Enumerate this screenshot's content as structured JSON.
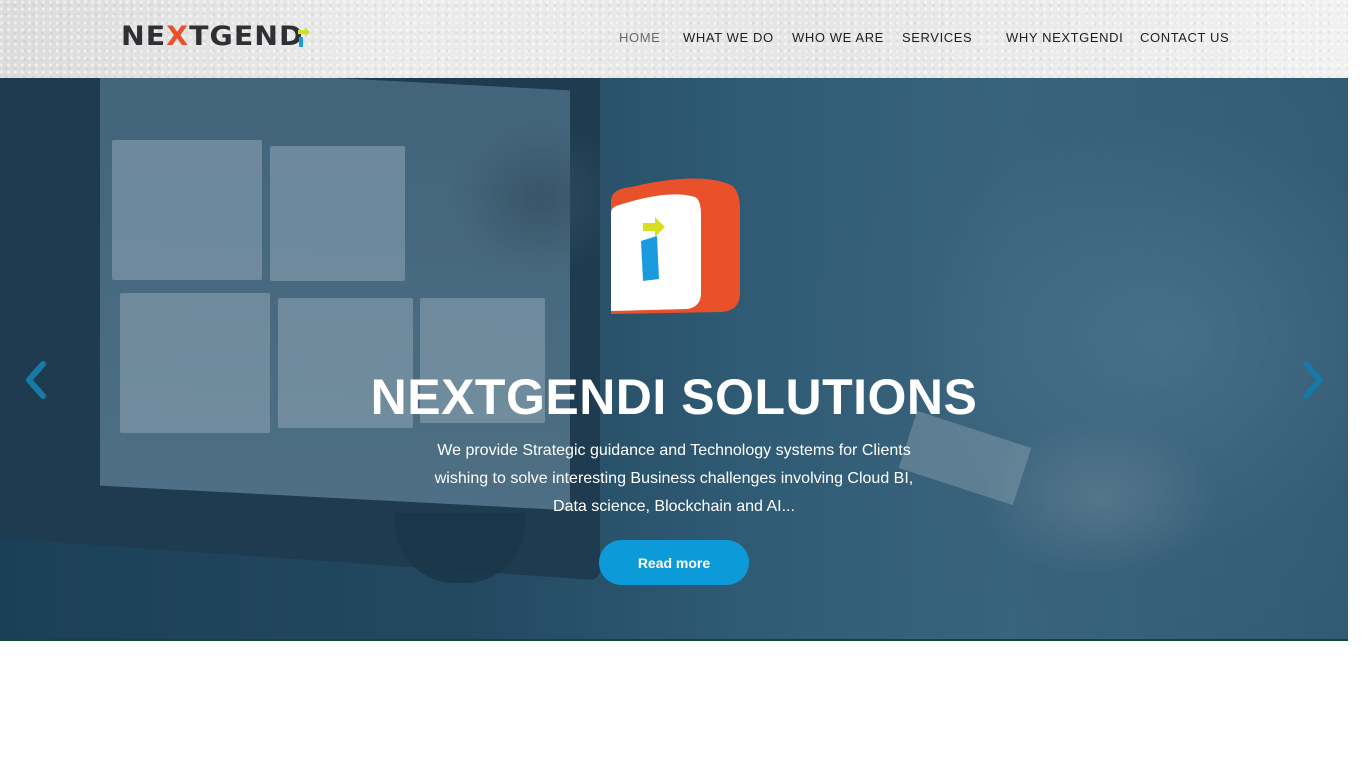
{
  "header": {
    "logo_text_pre": "NE",
    "logo_text_x": "X",
    "logo_text_post": "TGEND"
  },
  "nav": {
    "items": [
      {
        "label": "HOME",
        "active": true
      },
      {
        "label": "WHAT WE DO",
        "active": false
      },
      {
        "label": "WHO WE ARE",
        "active": false
      },
      {
        "label": "SERVICES",
        "active": false
      },
      {
        "label": "WHY NEXTGENDI",
        "active": false
      },
      {
        "label": "CONTACT US",
        "active": false
      }
    ]
  },
  "hero": {
    "title": "NEXTGENDI SOLUTIONS",
    "description": "We provide Strategic guidance and Technology systems for Clients wishing to solve interesting Business challenges involving Cloud BI, Data science, Blockchain and AI...",
    "button_label": "Read more",
    "prev_icon": "chevron-left-icon",
    "next_icon": "chevron-right-icon"
  },
  "colors": {
    "accent": "#0d9ad8",
    "brand_orange": "#e8512a",
    "brand_dark": "#2f3033",
    "brand_blue": "#1a9be0",
    "brand_yellow": "#d6df22"
  }
}
